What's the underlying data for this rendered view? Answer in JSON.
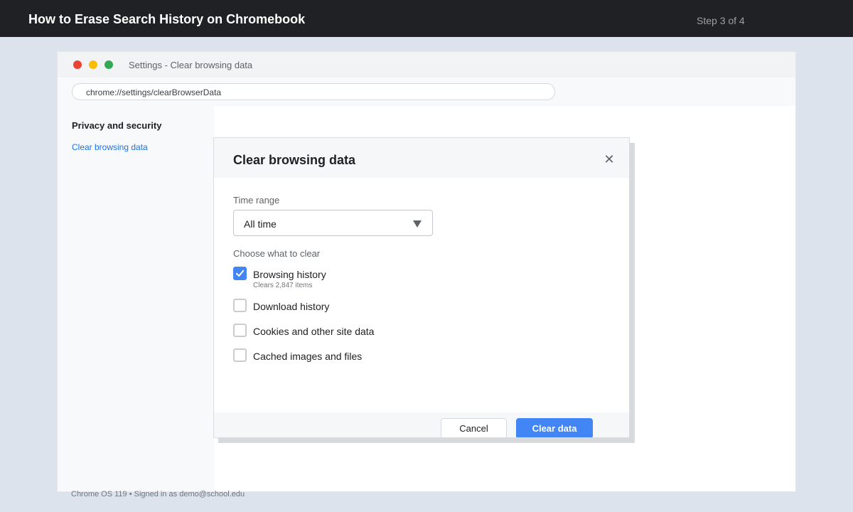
{
  "tutorial": {
    "title": "How to Erase Search History on Chromebook",
    "step": "Step 3 of 4"
  },
  "window": {
    "title": "Settings - Clear browsing data",
    "url": "chrome://settings/clearBrowserData"
  },
  "sidebar": {
    "heading": "Privacy and security",
    "link": "Clear browsing data"
  },
  "dialog": {
    "title": "Clear browsing data",
    "close_icon": "close-icon",
    "time_range_label": "Time range",
    "time_range_value": "All time",
    "choose_label": "Choose what to clear",
    "options": [
      {
        "label": "Browsing history",
        "sublabel": "Clears 2,847 items",
        "checked": true
      },
      {
        "label": "Download history",
        "checked": false
      },
      {
        "label": "Cookies and other site data",
        "checked": false
      },
      {
        "label": "Cached images and files",
        "checked": false
      }
    ],
    "cancel_label": "Cancel",
    "clear_label": "Clear data"
  },
  "footer": "Chrome OS 119 • Signed in as demo@school.edu",
  "colors": {
    "accent": "#4285f4",
    "topbar": "#202124",
    "background": "#dde3ed"
  }
}
